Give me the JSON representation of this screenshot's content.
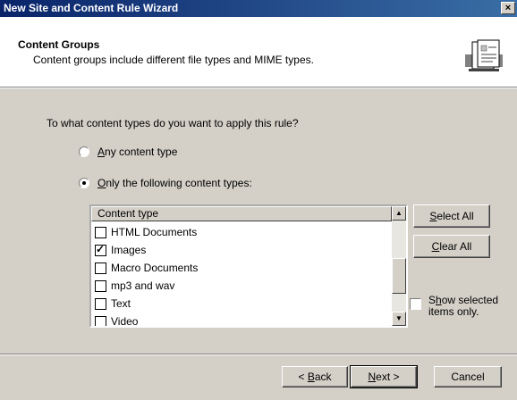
{
  "window": {
    "title": "New Site and Content Rule Wizard",
    "close_label": "×"
  },
  "header": {
    "title": "Content Groups",
    "subtitle": "Content groups include different file types and MIME types.",
    "icon": "wizard-page-icon"
  },
  "question": "To what content types do you want to apply this rule?",
  "options": {
    "any": {
      "mnemonic": "A",
      "rest": "ny content type",
      "selected": false
    },
    "only": {
      "mnemonic": "O",
      "rest": "nly the following content types:",
      "selected": true
    }
  },
  "list": {
    "column_header": "Content type",
    "items": [
      {
        "label": "HTML Documents",
        "checked": false
      },
      {
        "label": "Images",
        "checked": true
      },
      {
        "label": "Macro Documents",
        "checked": false
      },
      {
        "label": "mp3 and wav",
        "checked": false
      },
      {
        "label": "Text",
        "checked": false
      },
      {
        "label": "Video",
        "checked": false
      }
    ]
  },
  "side_buttons": {
    "select_all": {
      "mnemonic": "S",
      "rest": "elect All"
    },
    "clear_all": {
      "mnemonic": "C",
      "rest": "lear All"
    }
  },
  "show_selected": {
    "line1_pre": "S",
    "line1_mnemonic": "h",
    "line1_post": "ow selected",
    "line2": "items only.",
    "checked": false
  },
  "footer": {
    "back": {
      "prefix": "< ",
      "mnemonic": "B",
      "rest": "ack"
    },
    "next": {
      "mnemonic": "N",
      "rest": "ext >"
    },
    "cancel": "Cancel"
  }
}
